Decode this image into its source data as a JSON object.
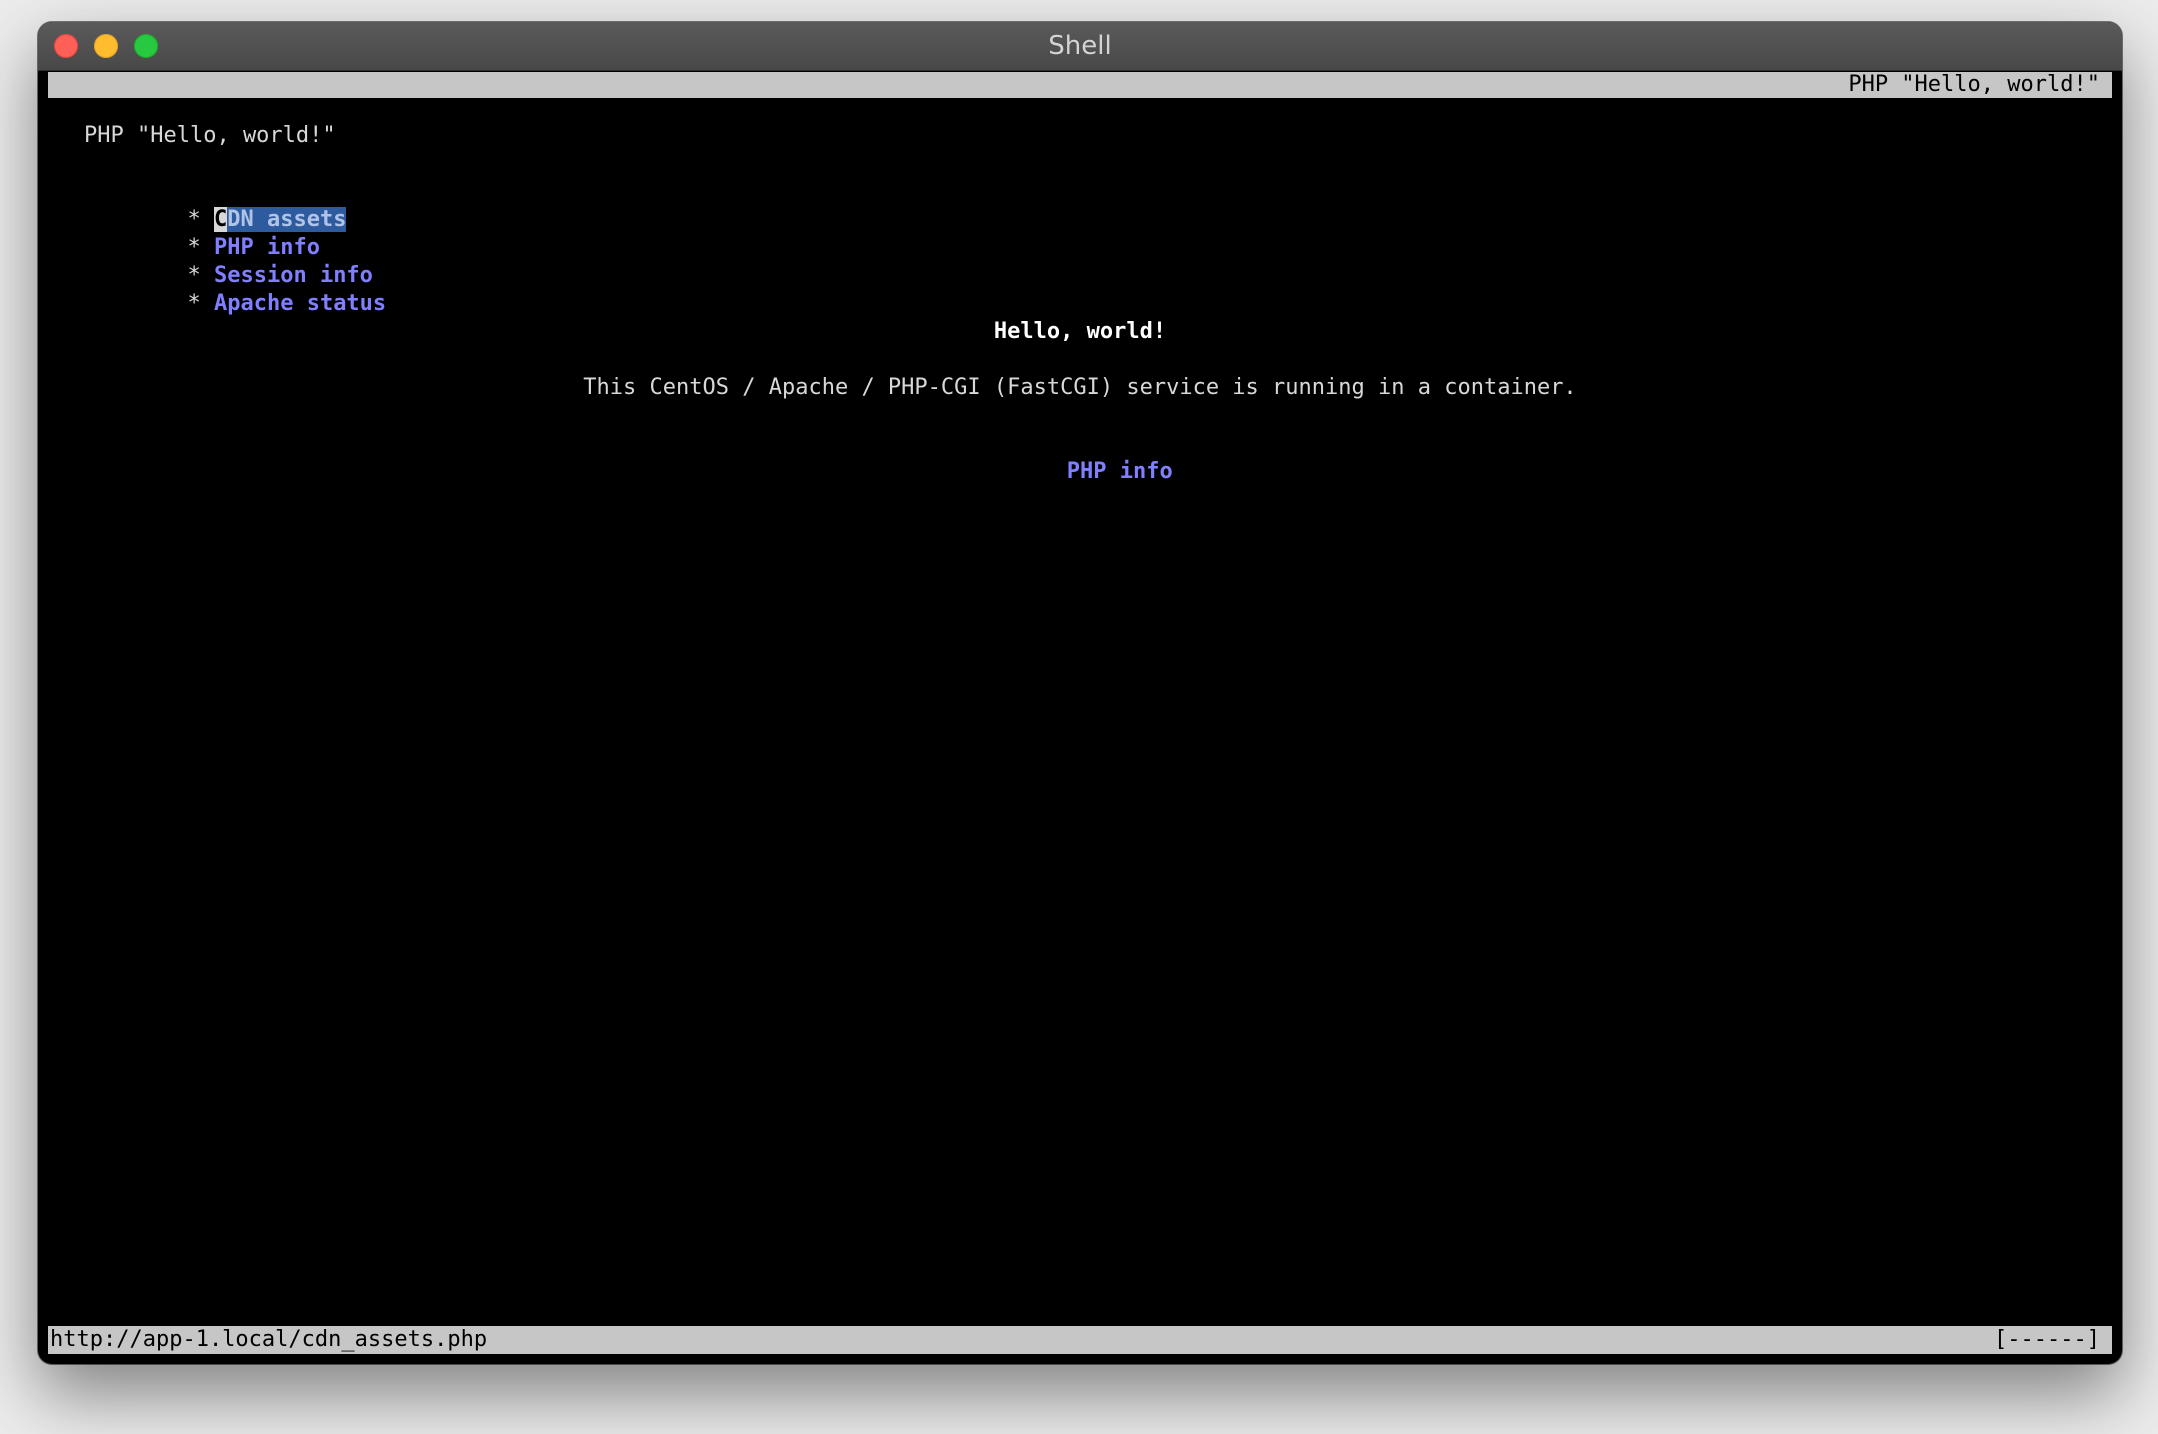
{
  "window": {
    "title": "Shell"
  },
  "terminal": {
    "top_right_title": "PHP \"Hello, world!\"",
    "page_title": "PHP \"Hello, world!\"",
    "bullet": "*",
    "nav": [
      {
        "first_char": "C",
        "rest": "DN assets",
        "label": "CDN assets"
      },
      {
        "label": "PHP info"
      },
      {
        "label": "Session info"
      },
      {
        "label": "Apache status"
      }
    ],
    "heading": "Hello, world!",
    "description": "This CentOS / Apache / PHP-CGI (FastCGI) service is running in a container.",
    "center_link": "PHP info",
    "status_url": "http://app-1.local/cdn_assets.php",
    "status_progress": "[------]"
  },
  "colors": {
    "link": "#7f7fff",
    "selection": "#2e5a9e",
    "bar": "#c6c6c6"
  }
}
